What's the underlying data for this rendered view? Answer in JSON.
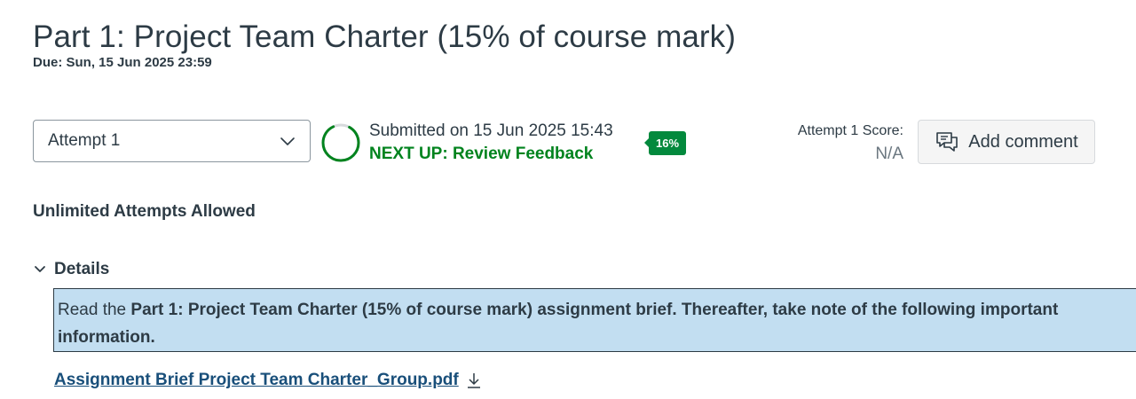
{
  "assignment": {
    "title": "Part 1: Project Team Charter (15% of course mark)",
    "due": "Due: Sun, 15 Jun 2025 23:59"
  },
  "attempt_select": {
    "selected": "Attempt 1"
  },
  "submission": {
    "submitted_text": "Submitted on 15 Jun 2025 15:43",
    "next_up": "NEXT UP: Review Feedback",
    "progress_percent_label": "16%",
    "progress_fraction": 0.16
  },
  "score": {
    "label": "Attempt 1 Score:",
    "value": "N/A"
  },
  "add_comment": {
    "label": "Add comment"
  },
  "attempts_info": "Unlimited Attempts Allowed",
  "details": {
    "label": "Details",
    "brief": {
      "prefix": "Read the ",
      "bold": "Part 1: Project Team Charter (15% of course mark) assignment brief. Thereafter, take note of the following important information."
    },
    "file_link": "Assignment Brief Project Team Charter_Group.pdf"
  },
  "colors": {
    "text": "#2d3b45",
    "success_green": "#00831e",
    "badge_green": "#03893d",
    "highlight_blue": "#c2def1",
    "link": "#194f7a"
  },
  "icons": {
    "select_chevron": "chevron-down-icon",
    "comment": "comment-icon",
    "details_chevron": "chevron-down-icon",
    "download": "download-icon",
    "progress": "progress-ring-icon"
  }
}
